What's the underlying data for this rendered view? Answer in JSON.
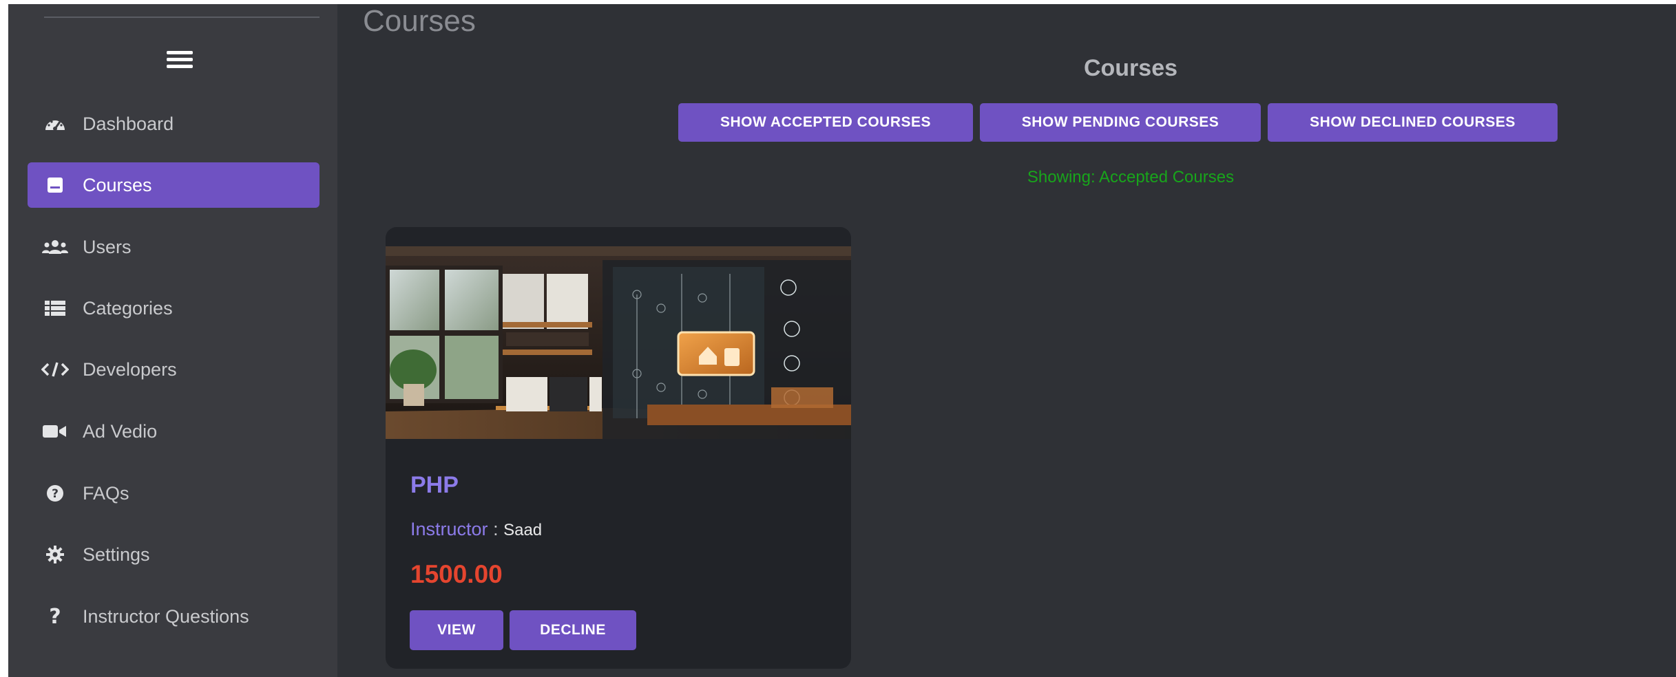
{
  "sidebar": {
    "menu_icon": "hamburger-icon",
    "items": [
      {
        "label": "Dashboard",
        "icon": "dashboard-gauge-icon",
        "active": false
      },
      {
        "label": "Courses",
        "icon": "book-icon",
        "active": true
      },
      {
        "label": "Users",
        "icon": "users-icon",
        "active": false
      },
      {
        "label": "Categories",
        "icon": "list-icon",
        "active": false
      },
      {
        "label": "Developers",
        "icon": "code-icon",
        "active": false
      },
      {
        "label": "Ad Vedio",
        "icon": "video-camera-icon",
        "active": false
      },
      {
        "label": "FAQs",
        "icon": "question-circle-icon",
        "active": false
      },
      {
        "label": "Settings",
        "icon": "gear-icon",
        "active": false
      },
      {
        "label": "Instructor Questions",
        "icon": "question-mark-icon",
        "active": false
      }
    ]
  },
  "header": {
    "page_title": "Courses"
  },
  "main": {
    "section_title": "Courses",
    "filters": {
      "accepted": "SHOW ACCEPTED COURSES",
      "pending": "SHOW PENDING COURSES",
      "declined": "SHOW DECLINED COURSES"
    },
    "status": "Showing: Accepted Courses",
    "courses": [
      {
        "title": "PHP",
        "instructor_label": "Instructor",
        "instructor_sep": ":",
        "instructor_name": "Saad",
        "price": "1500.00",
        "view_label": "VIEW",
        "decline_label": "DECLINE",
        "image": "smart-home-kitchen-image"
      }
    ]
  },
  "colors": {
    "accent": "#6f52c2",
    "background": "#2f3136",
    "sidebar": "#3a3b40",
    "card": "#212328",
    "price": "#e5452f",
    "status": "#18a51b",
    "course_title": "#8c7be9"
  }
}
